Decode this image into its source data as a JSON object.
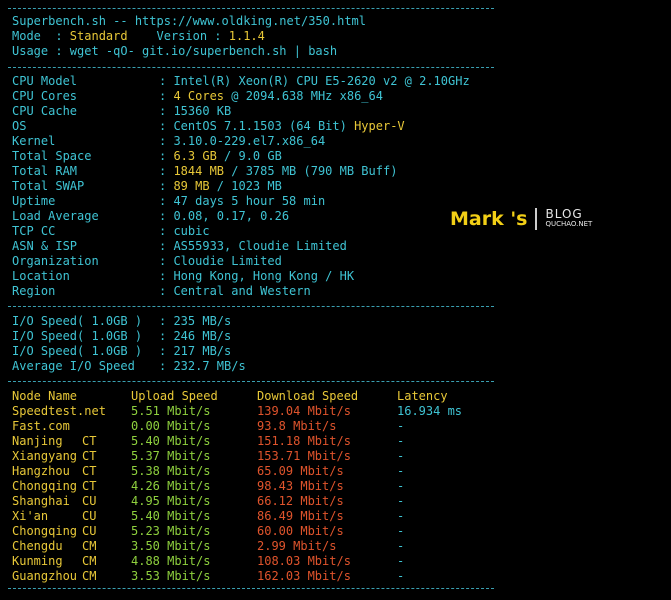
{
  "header": {
    "title_line": "Superbench.sh -- https://www.oldking.net/350.html",
    "mode_label": "Mode  : ",
    "mode_value": "Standard",
    "version_label": "    Version : ",
    "version_value": "1.1.4",
    "usage_line": "Usage : wget -qO- git.io/superbench.sh | bash"
  },
  "system": [
    {
      "label": "CPU Model",
      "value": "Intel(R) Xeon(R) CPU E5-2620 v2 @ 2.10GHz",
      "extra": ""
    },
    {
      "label": "CPU Cores",
      "value": "4 Cores",
      "extra": " @ 2094.638 MHz x86_64"
    },
    {
      "label": "CPU Cache",
      "value": "15360 KB",
      "extra": ""
    },
    {
      "label": "OS",
      "value": "CentOS 7.1.1503 (64 Bit)",
      "extra": " Hyper-V"
    },
    {
      "label": "Kernel",
      "value": "3.10.0-229.el7.x86_64",
      "extra": ""
    },
    {
      "label": "Total Space",
      "value": "6.3 GB",
      "extra": " / 9.0 GB"
    },
    {
      "label": "Total RAM",
      "value": "1844 MB",
      "extra": " / 3785 MB (790 MB Buff)"
    },
    {
      "label": "Total SWAP",
      "value": "89 MB",
      "extra": " / 1023 MB"
    },
    {
      "label": "Uptime",
      "value": "47 days 5 hour 58 min",
      "extra": ""
    },
    {
      "label": "Load Average",
      "value": "0.08, 0.17, 0.26",
      "extra": ""
    },
    {
      "label": "TCP CC",
      "value": "cubic",
      "extra": ""
    },
    {
      "label": "ASN & ISP",
      "value": "AS55933, Cloudie Limited",
      "extra": ""
    },
    {
      "label": "Organization",
      "value": "Cloudie Limited",
      "extra": ""
    },
    {
      "label": "Location",
      "value": "Hong Kong, Hong Kong / HK",
      "extra": ""
    },
    {
      "label": "Region",
      "value": "Central and Western",
      "extra": ""
    }
  ],
  "io": [
    {
      "label": "I/O Speed( 1.0GB )",
      "value": "235 MB/s"
    },
    {
      "label": "I/O Speed( 1.0GB )",
      "value": "246 MB/s"
    },
    {
      "label": "I/O Speed( 1.0GB )",
      "value": "217 MB/s"
    },
    {
      "label": "Average I/O Speed",
      "value": "232.7 MB/s"
    }
  ],
  "speed_headers": {
    "node": "Node Name",
    "upload": "Upload Speed",
    "download": "Download Speed",
    "latency": "Latency"
  },
  "speed": [
    {
      "node": "Speedtest.net",
      "isp": "",
      "upload": "5.51 Mbit/s",
      "download": "139.04 Mbit/s",
      "latency": "16.934 ms"
    },
    {
      "node": "Fast.com",
      "isp": "",
      "upload": "0.00 Mbit/s",
      "download": "93.8 Mbit/s",
      "latency": "-"
    },
    {
      "node": "Nanjing",
      "isp": "CT",
      "upload": "5.40 Mbit/s",
      "download": "151.18 Mbit/s",
      "latency": "-"
    },
    {
      "node": "Xiangyang",
      "isp": "CT",
      "upload": "5.37 Mbit/s",
      "download": "153.71 Mbit/s",
      "latency": "-"
    },
    {
      "node": "Hangzhou",
      "isp": "CT",
      "upload": "5.38 Mbit/s",
      "download": "65.09 Mbit/s",
      "latency": "-"
    },
    {
      "node": "Chongqing",
      "isp": "CT",
      "upload": "4.26 Mbit/s",
      "download": "98.43 Mbit/s",
      "latency": "-"
    },
    {
      "node": "Shanghai",
      "isp": "CU",
      "upload": "4.95 Mbit/s",
      "download": "66.12 Mbit/s",
      "latency": "-"
    },
    {
      "node": "Xi'an",
      "isp": "CU",
      "upload": "5.40 Mbit/s",
      "download": "86.49 Mbit/s",
      "latency": "-"
    },
    {
      "node": "Chongqing",
      "isp": "CU",
      "upload": "5.23 Mbit/s",
      "download": "60.00 Mbit/s",
      "latency": "-"
    },
    {
      "node": "Chengdu",
      "isp": "CM",
      "upload": "3.50 Mbit/s",
      "download": "2.99 Mbit/s",
      "latency": "-"
    },
    {
      "node": "Kunming",
      "isp": "CM",
      "upload": "4.88 Mbit/s",
      "download": "108.03 Mbit/s",
      "latency": "-"
    },
    {
      "node": "Guangzhou",
      "isp": "CM",
      "upload": "3.53 Mbit/s",
      "download": "162.03 Mbit/s",
      "latency": "-"
    }
  ],
  "watermark": {
    "mark": "Mark 's",
    "blog": "BLOG",
    "site": "QUCHAO.NET"
  },
  "colors": {
    "cyan": "#3fc4d4",
    "yellow": "#e8c838",
    "green": "#8fd13e",
    "red": "#e0542c",
    "background": "#000000"
  }
}
